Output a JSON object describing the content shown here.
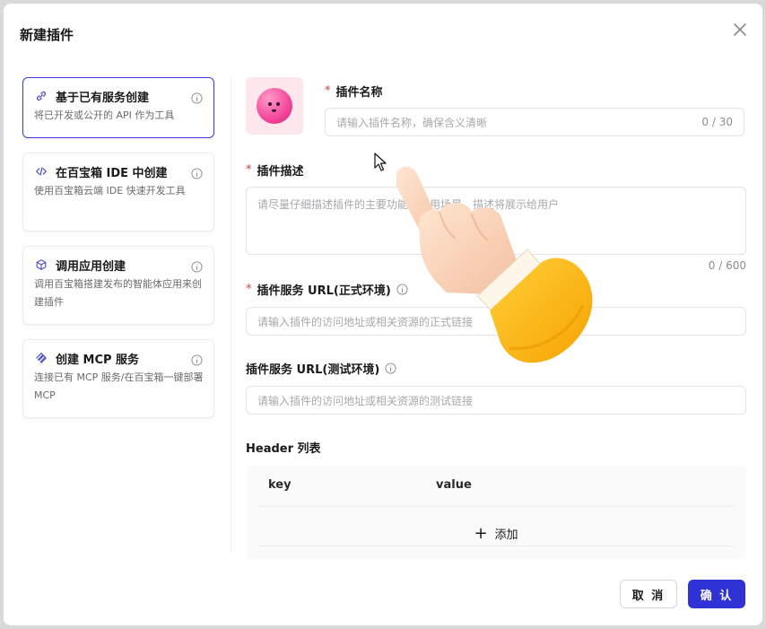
{
  "dialog": {
    "title": "新建插件"
  },
  "sidebar": {
    "items": [
      {
        "title": "基于已有服务创建",
        "desc": "将已开发或公开的 API 作为工具",
        "icon": "link-icon"
      },
      {
        "title": "在百宝箱 IDE 中创建",
        "desc": "使用百宝箱云端 IDE 快速开发工具",
        "icon": "code-icon"
      },
      {
        "title": "调用应用创建",
        "desc": "调用百宝箱搭建发布的智能体应用来创建插件",
        "icon": "cube-icon"
      },
      {
        "title": "创建 MCP 服务",
        "desc": "连接已有 MCP 服务/在百宝箱一键部署 MCP",
        "icon": "mcp-icon"
      }
    ]
  },
  "form": {
    "name": {
      "required": "*",
      "label": "插件名称",
      "placeholder": "请输入插件名称，确保含义清晰",
      "count": "0 / 30"
    },
    "desc": {
      "required": "*",
      "label": "插件描述",
      "placeholder": "请尽量仔细描述插件的主要功能和使用场景，描述将展示给用户",
      "count": "0 / 600"
    },
    "prod_url": {
      "required": "*",
      "label": "插件服务 URL(正式环境)",
      "placeholder": "请输入插件的访问地址或相关资源的正式链接"
    },
    "test_url": {
      "label": "插件服务 URL(测试环境)",
      "placeholder": "请输入插件的访问地址或相关资源的测试链接"
    },
    "header": {
      "label": "Header 列表",
      "col_key": "key",
      "col_value": "value",
      "add_label": "添加"
    }
  },
  "footer": {
    "cancel": "取 消",
    "confirm": "确 认"
  },
  "colors": {
    "accent": "#2f33d6",
    "required": "#e0393e",
    "avatar_bg": "#fde6ec"
  }
}
